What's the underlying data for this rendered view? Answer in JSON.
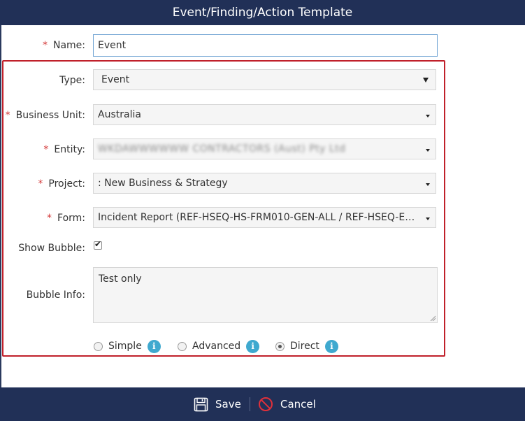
{
  "dialog": {
    "title": "Event/Finding/Action Template"
  },
  "form": {
    "name": {
      "label": "Name:",
      "value": "Event",
      "required": true
    },
    "type": {
      "label": "Type:",
      "value": "Event"
    },
    "business_unit": {
      "label": "Business Unit:",
      "value": "Australia",
      "required": true
    },
    "entity": {
      "label": "Entity:",
      "value": "WKDAWWWWWW CONTRACTORS (Aust) Pty Ltd",
      "required": true
    },
    "project": {
      "label": "Project:",
      "value": ": New Business & Strategy",
      "required": true
    },
    "form_field": {
      "label": "Form:",
      "value": "Incident Report (REF-HSEQ-HS-FRM010-GEN-ALL  / REF-HSEQ-ENV...",
      "required": true
    },
    "show_bubble": {
      "label": "Show Bubble:",
      "checked": true
    },
    "bubble_info": {
      "label": "Bubble Info:",
      "value": "Test only"
    },
    "required_mark": "*",
    "mode_options": [
      {
        "label": "Simple",
        "selected": false
      },
      {
        "label": "Advanced",
        "selected": false
      },
      {
        "label": "Direct",
        "selected": true
      }
    ],
    "info_glyph": "i"
  },
  "footer": {
    "save_label": "Save",
    "cancel_label": "Cancel"
  },
  "colors": {
    "header_bg": "#213057",
    "highlight_border": "#c0202a",
    "info_icon": "#3fa9cf",
    "required": "#d43b3b"
  }
}
